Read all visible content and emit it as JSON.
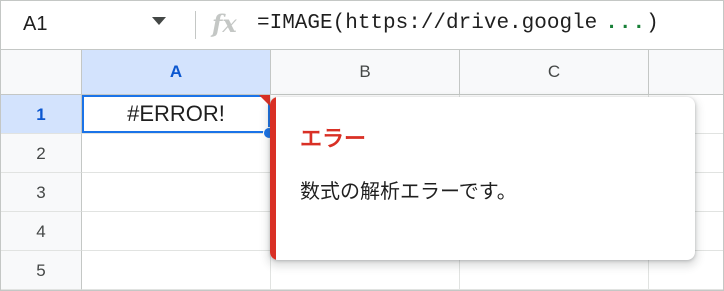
{
  "formula_bar": {
    "name_box": "A1",
    "fx_label": "fx",
    "formula": "=IMAGE(https://drive.google",
    "formula_ellipsis": "...",
    "formula_close": ")"
  },
  "columns": [
    "A",
    "B",
    "C"
  ],
  "rows": [
    "1",
    "2",
    "3",
    "4",
    "5"
  ],
  "cells": {
    "A1": "#ERROR!"
  },
  "error_tooltip": {
    "title": "エラー",
    "message": "数式の解析エラーです。"
  },
  "colors": {
    "selection": "#1a73e8",
    "header_selected": "#d3e3fd",
    "error": "#d93025",
    "ellipsis": "#188038"
  }
}
